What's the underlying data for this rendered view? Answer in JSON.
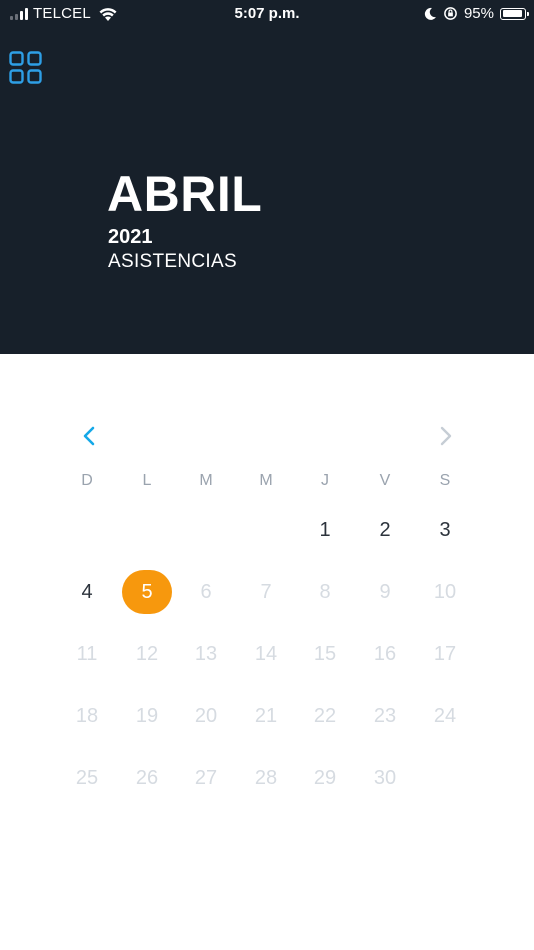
{
  "status_bar": {
    "carrier": "TELCEL",
    "time": "5:07 p.m.",
    "battery": "95%"
  },
  "header": {
    "menu_icon": "grid-icon",
    "month": "ABRIL",
    "year": "2021",
    "subtitle": "ASISTENCIAS"
  },
  "calendar": {
    "weekdays": [
      "D",
      "L",
      "M",
      "M",
      "J",
      "V",
      "S"
    ],
    "prev_icon": "chevron-left-icon",
    "next_icon": "chevron-right-icon",
    "days": [
      "1",
      "2",
      "3",
      "4",
      "5",
      "6",
      "7",
      "8",
      "9",
      "10",
      "11",
      "12",
      "13",
      "14",
      "15",
      "16",
      "17",
      "18",
      "19",
      "20",
      "21",
      "22",
      "23",
      "24",
      "25",
      "26",
      "27",
      "28",
      "29",
      "30"
    ],
    "first_weekday_index": 4,
    "enabled_through": 5,
    "selected": "5"
  },
  "colors": {
    "header_bg": "#17202a",
    "accent_blue": "#2e9fe6",
    "selected_orange": "#f7980d",
    "active_text": "#2c333c",
    "disabled_text": "#d6dbe1",
    "weekday_text": "#9aa3ae"
  }
}
